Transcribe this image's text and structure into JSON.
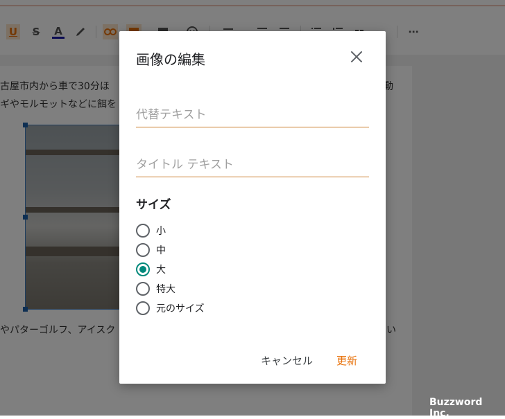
{
  "editor": {
    "paragraph1_line1_left": "古屋市内から車で30分ほ",
    "paragraph1_line1_right": "動",
    "paragraph1_line2": "ギやモルモットなどに餌を",
    "paragraph2_left": "やパターゴルフ、アイスク",
    "paragraph2_right": "い"
  },
  "toolbar": {
    "items": [
      {
        "name": "underline-icon",
        "glyph": "U",
        "active": true
      },
      {
        "name": "strikethrough-icon",
        "glyph": "S"
      },
      {
        "name": "text-color-icon",
        "glyph": "A"
      },
      {
        "name": "highlight-icon",
        "glyph": "✎"
      },
      {
        "name": "link-icon",
        "glyph": "⛓",
        "active": true
      },
      {
        "name": "image-icon",
        "glyph": "▣",
        "active": true
      },
      {
        "name": "video-icon",
        "glyph": "▦"
      },
      {
        "name": "emoji-icon",
        "glyph": "☺"
      },
      {
        "name": "align-icon",
        "glyph": "≡"
      },
      {
        "name": "indent-increase-icon",
        "glyph": "⇥"
      },
      {
        "name": "indent-decrease-icon",
        "glyph": "⇤"
      },
      {
        "name": "bulleted-list-icon",
        "glyph": "☰"
      },
      {
        "name": "numbered-list-icon",
        "glyph": "☷"
      },
      {
        "name": "quote-icon",
        "glyph": "❝"
      },
      {
        "name": "more-icon",
        "glyph": "⋯"
      }
    ],
    "text_color": "#1a1aa6",
    "active_bg": "#fbe3c9",
    "accent": "#e8710a"
  },
  "dialog": {
    "title": "画像の編集",
    "alt_text_placeholder": "代替テキスト",
    "title_text_placeholder": "タイトル テキスト",
    "size_title": "サイズ",
    "size_options": [
      {
        "label": "小",
        "checked": false
      },
      {
        "label": "中",
        "checked": false
      },
      {
        "label": "大",
        "checked": true
      },
      {
        "label": "特大",
        "checked": false
      },
      {
        "label": "元のサイズ",
        "checked": false
      }
    ],
    "cancel_label": "キャンセル",
    "update_label": "更新",
    "accent_color": "#e8710a",
    "radio_color": "#00897b"
  },
  "watermark": "Buzzword Inc."
}
